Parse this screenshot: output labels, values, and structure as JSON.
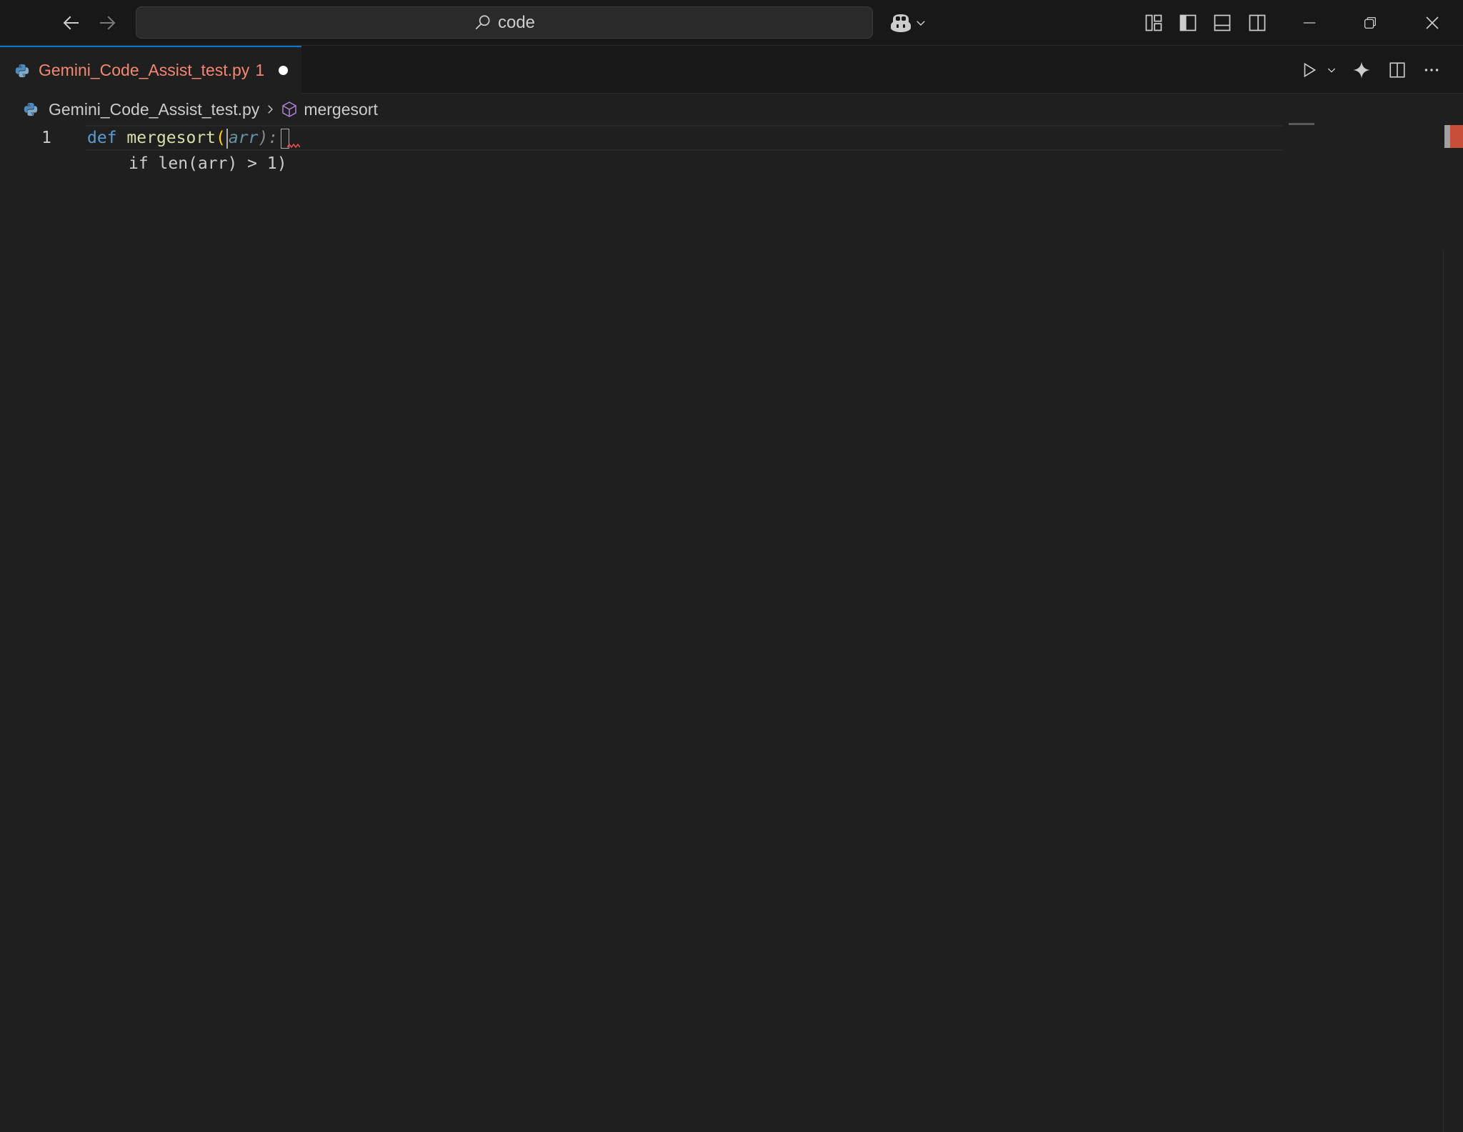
{
  "titlebar": {
    "search_text": "code"
  },
  "tabs": [
    {
      "label": "Gemini_Code_Assist_test.py",
      "problem_count": "1",
      "modified": true
    }
  ],
  "breadcrumb": {
    "file": "Gemini_Code_Assist_test.py",
    "symbol": "mergesort"
  },
  "editor": {
    "line_numbers": [
      "1"
    ],
    "line1": {
      "keyword": "def",
      "function": "mergesort",
      "open_paren": "(",
      "param": "arr",
      "close": "):"
    },
    "ghost_suggestion": "if len(arr) > 1)"
  },
  "colors": {
    "accent": "#0078d4",
    "tab_error": "#f48771",
    "keyword": "#569cd6",
    "function": "#dcdcaa",
    "error": "#c74e39"
  },
  "icons": {
    "nav": [
      "arrow-left-icon",
      "arrow-right-icon"
    ],
    "layout": [
      "customize-layout-icon",
      "toggle-primary-sidebar-icon",
      "toggle-panel-icon",
      "toggle-secondary-sidebar-icon"
    ],
    "window": [
      "minimize-icon",
      "restore-icon",
      "close-icon"
    ],
    "editor_actions": [
      "run-icon",
      "chevron-down-icon",
      "gemini-sparkle-icon",
      "split-editor-icon",
      "more-actions-icon"
    ]
  }
}
